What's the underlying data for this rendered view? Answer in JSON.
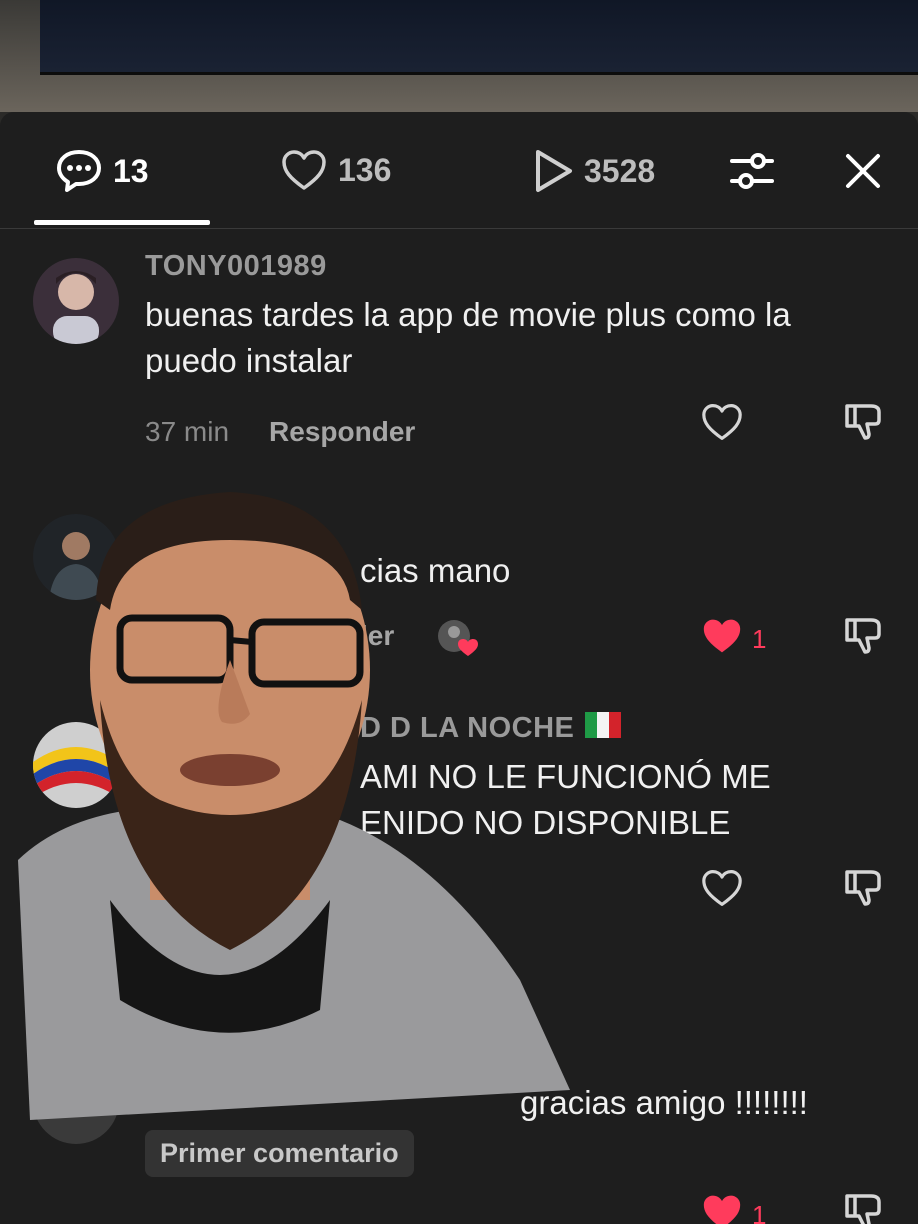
{
  "header": {
    "comments_count": "13",
    "likes_count": "136",
    "views_count": "3528"
  },
  "comments": [
    {
      "username": "TONY001989",
      "text": "buenas tardes la app de movie plus como la puedo instalar",
      "time": "37 min",
      "reply_label": "Responder"
    },
    {
      "username": "",
      "text": "cias mano",
      "reply_label": "ler",
      "likes": "1"
    },
    {
      "username": "D D LA NOCHE",
      "text": "AMI NO LE FUNCIONÓ ME ENIDO NO DISPONIBLE"
    },
    {
      "text": "gracias amigo !!!!!!!!",
      "badge": "Primer comentario",
      "likes": "1"
    }
  ],
  "colors": {
    "background": "#1e1e1e",
    "accent_like": "#ff3b5c",
    "text": "#f0f0f0",
    "muted": "#9a9a9a"
  },
  "icons": [
    "comment-icon",
    "heart-icon",
    "play-icon",
    "filter-icon",
    "close-icon",
    "dislike-icon"
  ]
}
